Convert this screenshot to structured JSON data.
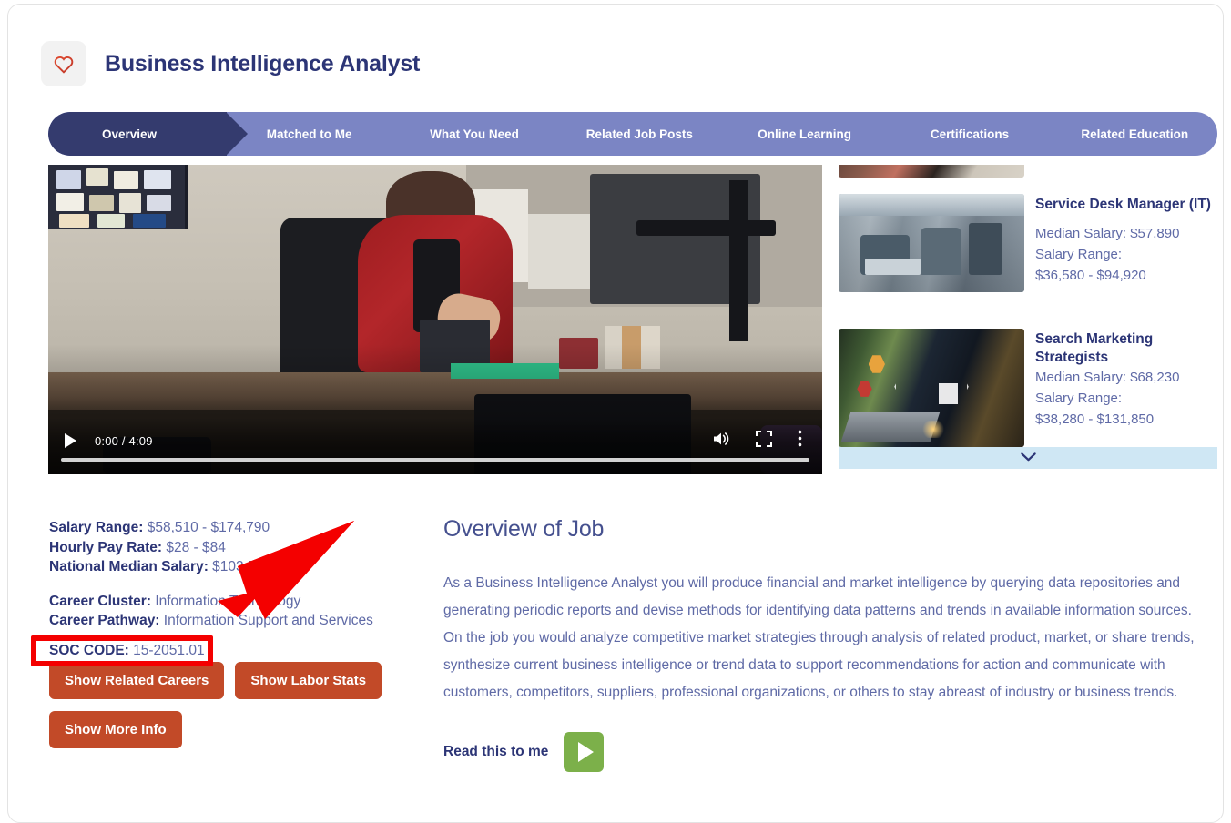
{
  "header": {
    "favorite_icon": "heart-icon",
    "title": "Business Intelligence Analyst"
  },
  "tabs": [
    {
      "label": "Overview",
      "active": true
    },
    {
      "label": "Matched to Me",
      "active": false
    },
    {
      "label": "What You Need",
      "active": false
    },
    {
      "label": "Related Job Posts",
      "active": false
    },
    {
      "label": "Online Learning",
      "active": false
    },
    {
      "label": "Certifications",
      "active": false
    },
    {
      "label": "Related Education",
      "active": false
    }
  ],
  "video": {
    "play_icon": "play-icon",
    "time": "0:00 / 4:09",
    "volume_icon": "volume-icon",
    "fullscreen_icon": "fullscreen-icon",
    "more_icon": "more-options-icon",
    "progress_percent": 0
  },
  "related_careers": [
    {
      "title": "Service Desk Manager (IT)",
      "median_label": "Median Salary: $57,890",
      "range_label": "Salary Range:",
      "range_value": "$36,580 - $94,920",
      "thumbnail": "office-workers-thumbnail"
    },
    {
      "title": "Search Marketing Strategists",
      "median_label": "Median Salary: $68,230",
      "range_label": "Salary Range:",
      "range_value": "$38,280 - $131,850",
      "thumbnail": "digital-marketing-laptop-thumbnail"
    }
  ],
  "side_expand": {
    "icon": "chevron-down-icon"
  },
  "info": {
    "salary_range_label": "Salary Range:",
    "salary_range_value": "$58,510 - $174,790",
    "hourly_label": "Hourly Pay Rate:",
    "hourly_value": "$28 - $84",
    "median_label": "National Median Salary:",
    "median_value": "$103,500",
    "cluster_label": "Career Cluster:",
    "cluster_value": "Information Technology",
    "pathway_label": "Career Pathway:",
    "pathway_value": "Information Support and Services",
    "soc_label": "SOC CODE:",
    "soc_value": "15-2051.01"
  },
  "buttons": {
    "show_related_careers": "Show Related Careers",
    "show_labor_stats": "Show Labor Stats",
    "show_more_info": "Show More Info"
  },
  "overview": {
    "heading": "Overview of Job",
    "body": "As a Business Intelligence Analyst you will produce financial and market intelligence by querying data repositories and generating periodic reports and devise methods for identifying data patterns and trends in available information sources. On the job you would analyze competitive market strategies through analysis of related product, market, or share trends, synthesize current business intelligence or trend data to support recommendations for action and communicate with customers, competitors, suppliers, professional organizations, or others to stay abreast of industry or business trends.",
    "read_label": "Read this to me",
    "read_icon": "play-icon"
  },
  "annotations": {
    "highlight_color": "#f40000",
    "arrow_color": "#f40000",
    "highlighted_field": "SOC CODE: 15-2051.01"
  },
  "colors": {
    "brand_navy": "#2c3576",
    "tab_active": "#343b6e",
    "tab_inactive": "#7b85c4",
    "button_orange": "#c24a28",
    "read_green": "#7cb04a",
    "expand_blue": "#cfe7f4",
    "body_text": "#5f6aa6"
  }
}
